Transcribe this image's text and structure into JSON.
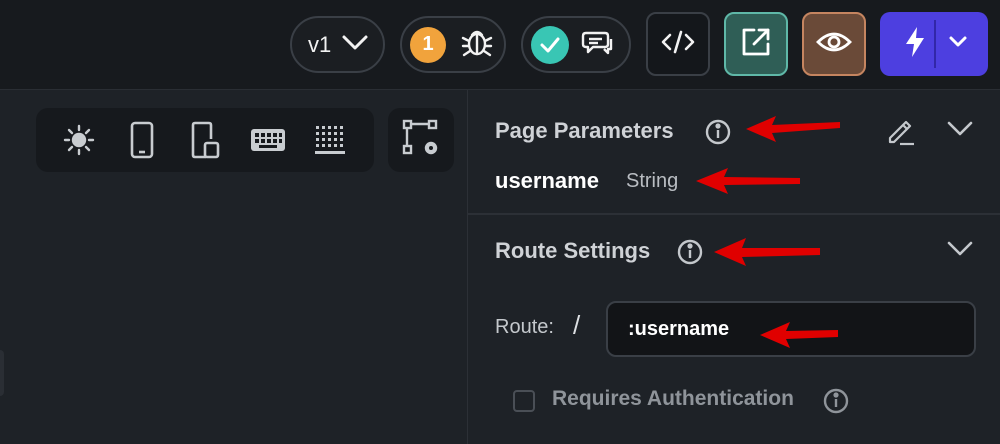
{
  "topbar": {
    "version_label": "v1",
    "issue_count": "1",
    "icons": [
      "chevron-down-icon",
      "bug-icon",
      "check-icon",
      "chat-icon",
      "code-icon",
      "share-icon",
      "eye-icon",
      "lightning-icon",
      "chevron-down-icon"
    ]
  },
  "toolbox": {
    "icons": [
      "sun-icon",
      "phone-icon",
      "tablet-icon",
      "keyboard-icon",
      "grid-icon",
      "flow-settings-icon"
    ]
  },
  "panel": {
    "page_params": {
      "title": "Page Parameters",
      "param_name": "username",
      "param_type": "String"
    },
    "route_settings": {
      "title": "Route Settings",
      "route_label": "Route:",
      "route_prefix": "/",
      "route_value": ":username",
      "requires_auth_label": "Requires Authentication"
    }
  },
  "colors": {
    "accent_run": "#4d3fe0",
    "share": "#2f5e56",
    "preview": "#6a4a38",
    "badge": "#f1a33c",
    "check": "#39c6b4",
    "annotation_arrow": "#e00000"
  }
}
